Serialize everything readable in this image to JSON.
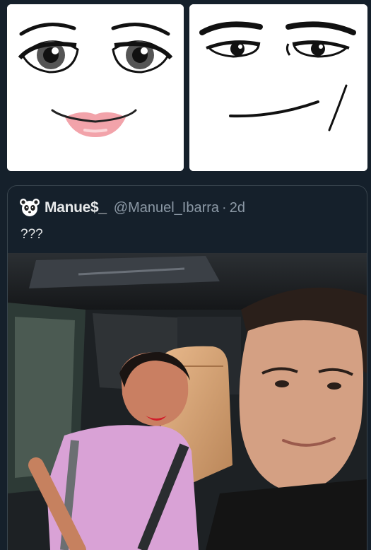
{
  "faces": {
    "left": {
      "icon": "roblox-woman-face"
    },
    "right": {
      "icon": "roblox-man-face"
    }
  },
  "tweet": {
    "display_name": "Manue$_",
    "handle": "@Manuel_Ibarra",
    "separator": "·",
    "time": "2d",
    "text": "???",
    "avatar_icon": "panda-icon",
    "media_description_icon": "car-selfie-photo"
  },
  "colors": {
    "background": "#15202b",
    "border": "#38444d",
    "text_primary": "#e7e9ea",
    "text_secondary": "#8b98a5"
  }
}
